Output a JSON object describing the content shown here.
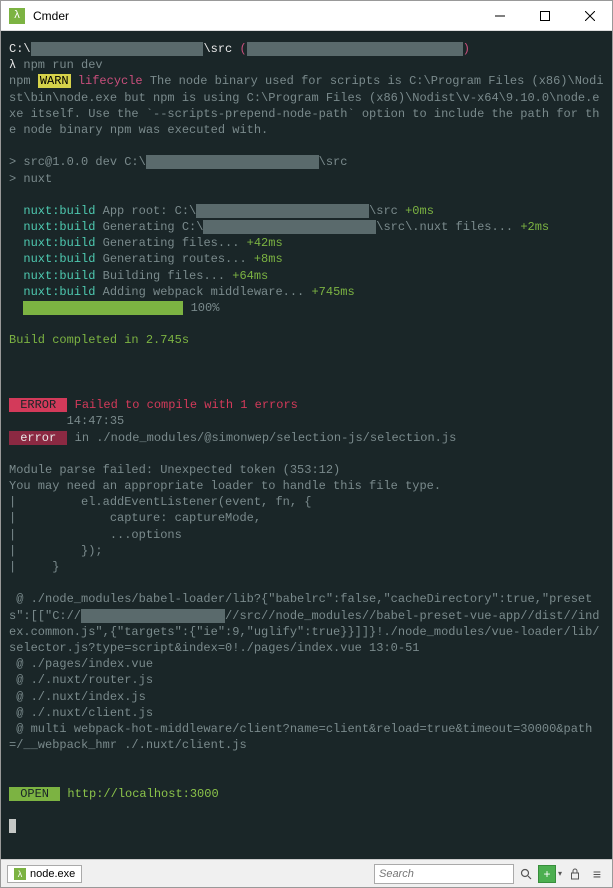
{
  "window": {
    "title": "Cmder"
  },
  "terminal": {
    "prompt_path_prefix": "C:\\",
    "prompt_path_suffix": "\\src",
    "prompt_branch": "(",
    "prompt_branch_end": ")",
    "command": "npm run dev",
    "warn_label": "WARN",
    "warn_prefix": "npm ",
    "warn_category": " lifecycle",
    "warn_text": " The node binary used for scripts is C:\\Program Files (x86)\\Nodist\\bin\\node.exe but npm is using C:\\Program Files (x86)\\Nodist\\v-x64\\9.10.0\\node.exe itself. Use the `--scripts-prepend-node-path` option to include the path for the node binary npm was executed with.",
    "script_line1_a": "> src@1.0.0 dev C:\\",
    "script_line1_b": "\\src",
    "script_line2": "> nuxt",
    "build": [
      {
        "label": "nuxt:build",
        "text": " App root: C:\\",
        "redact": true,
        "suffix": "\\src ",
        "time": "+0ms"
      },
      {
        "label": "nuxt:build",
        "text": " Generating C:\\",
        "redact": true,
        "suffix": "\\src\\.nuxt files... ",
        "time": "+2ms"
      },
      {
        "label": "nuxt:build",
        "text": " Generating files... ",
        "redact": false,
        "suffix": "",
        "time": "+42ms"
      },
      {
        "label": "nuxt:build",
        "text": " Generating routes... ",
        "redact": false,
        "suffix": "",
        "time": "+8ms"
      },
      {
        "label": "nuxt:build",
        "text": " Building files... ",
        "redact": false,
        "suffix": "",
        "time": "+64ms"
      },
      {
        "label": "nuxt:build",
        "text": " Adding webpack middleware... ",
        "redact": false,
        "suffix": "",
        "time": "+745ms"
      }
    ],
    "progress_percent": " 100%",
    "build_complete": "Build completed in 2.745s",
    "error_label": " ERROR ",
    "error_heading": " Failed to compile with 1 errors",
    "error_time": "14:47:35",
    "error_sub_label": " error ",
    "error_in": " in ./node_modules/@simonwep/selection-js/selection.js",
    "error_body": "Module parse failed: Unexpected token (353:12)\nYou may need an appropriate loader to handle this file type.\n|         el.addEventListener(event, fn, {\n|             capture: captureMode,\n|             ...options\n|         });\n|     }",
    "stack_pre": " @ ./node_modules/babel-loader/lib?{\"babelrc\":false,\"cacheDirectory\":true,\"presets\":[[\"C://",
    "stack_post": "//src//node_modules//babel-preset-vue-app//dist//index.common.js\",{\"targets\":{\"ie\":9,\"uglify\":true}}]]}!./node_modules/vue-loader/lib/selector.js?type=script&index=0!./pages/index.vue 13:0-51",
    "stack_lines": [
      " @ ./pages/index.vue",
      " @ ./.nuxt/router.js",
      " @ ./.nuxt/index.js",
      " @ ./.nuxt/client.js",
      " @ multi webpack-hot-middleware/client?name=client&reload=true&timeout=30000&path=/__webpack_hmr ./.nuxt/client.js"
    ],
    "open_label": " OPEN ",
    "open_url": "http://localhost:3000"
  },
  "statusbar": {
    "tab_label": "node.exe",
    "search_placeholder": "Search"
  }
}
